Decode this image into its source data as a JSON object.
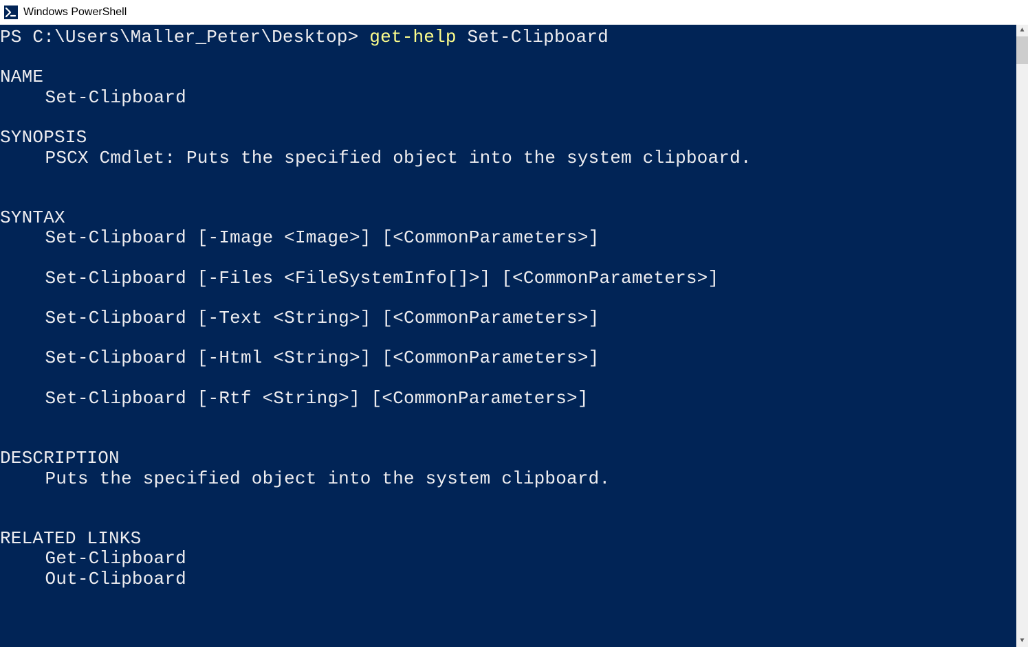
{
  "window": {
    "title": "Windows PowerShell"
  },
  "terminal": {
    "prompt": "PS C:\\Users\\Maller_Peter\\Desktop> ",
    "command_cmdlet": "get-help",
    "command_arg": " Set-Clipboard",
    "sections": {
      "name_header": "NAME",
      "name_value": "Set-Clipboard",
      "synopsis_header": "SYNOPSIS",
      "synopsis_value": "PSCX Cmdlet: Puts the specified object into the system clipboard.",
      "syntax_header": "SYNTAX",
      "syntax_lines": [
        "Set-Clipboard [-Image <Image>] [<CommonParameters>]",
        "Set-Clipboard [-Files <FileSystemInfo[]>] [<CommonParameters>]",
        "Set-Clipboard [-Text <String>] [<CommonParameters>]",
        "Set-Clipboard [-Html <String>] [<CommonParameters>]",
        "Set-Clipboard [-Rtf <String>] [<CommonParameters>]"
      ],
      "description_header": "DESCRIPTION",
      "description_value": "Puts the specified object into the system clipboard.",
      "related_header": "RELATED LINKS",
      "related_links": [
        "Get-Clipboard",
        "Out-Clipboard"
      ]
    }
  }
}
